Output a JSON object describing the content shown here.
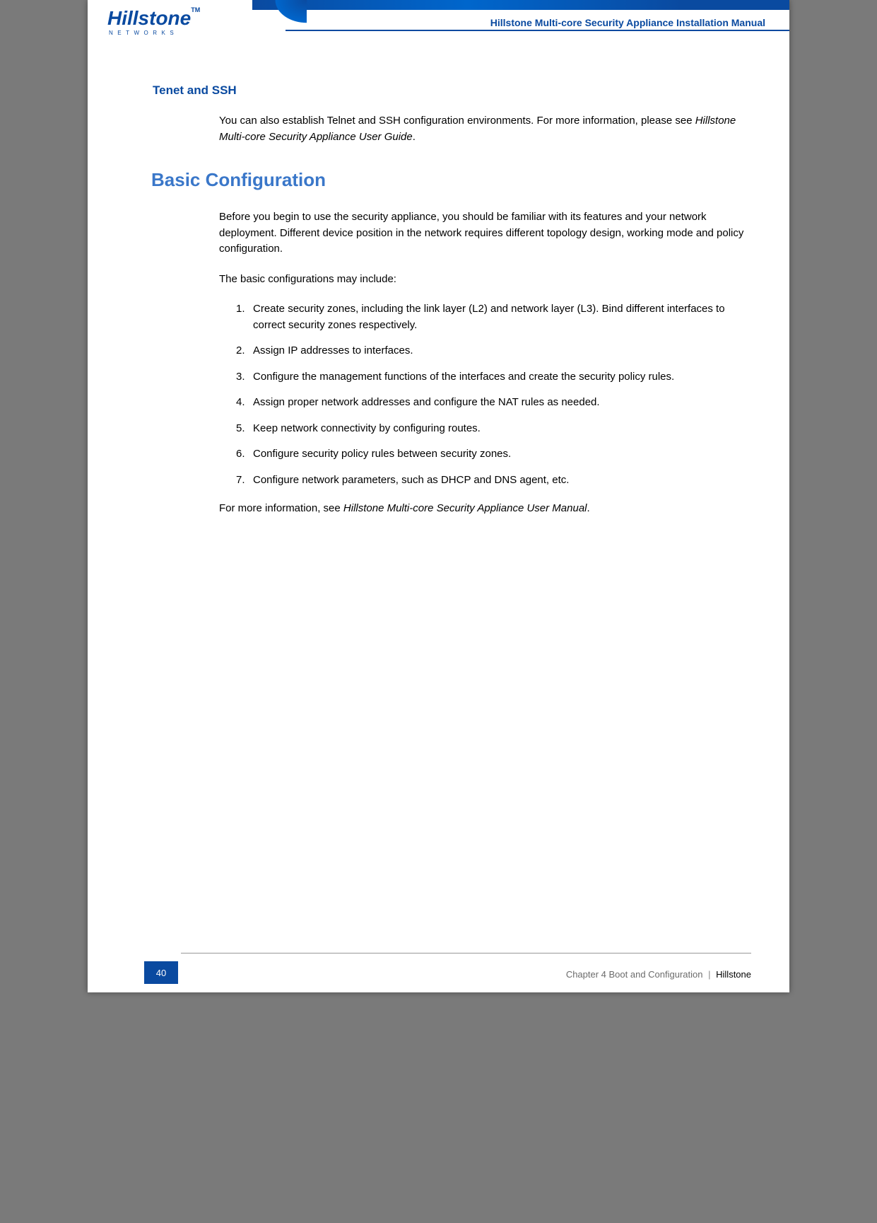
{
  "header": {
    "logo_main": "Hillstone",
    "logo_tm": "TM",
    "logo_sub": "NETWORKS",
    "title": "Hillstone Multi-core Security Appliance Installation Manual"
  },
  "section1": {
    "heading": "Tenet and SSH",
    "para_lead": "You can also establish Telnet and SSH configuration environments. For more information, please see ",
    "para_ref": "Hillstone Multi-core Security Appliance User Guide",
    "para_end": "."
  },
  "section2": {
    "heading": "Basic Configuration",
    "intro": "Before you begin to use the security appliance, you should be familiar with its features and your network deployment. Different device position in the network requires different topology design, working mode and policy configuration.",
    "lead": "The basic configurations may include:",
    "items": [
      "Create security zones, including the link layer (L2) and network layer (L3). Bind different interfaces to correct security zones respectively.",
      "Assign IP addresses to interfaces.",
      "Configure the management functions of the interfaces and create the security policy rules.",
      "Assign proper network addresses and configure the NAT rules as needed.",
      "Keep network connectivity by configuring routes.",
      "Configure security policy rules between security zones.",
      "Configure network parameters, such as DHCP and DNS agent, etc."
    ],
    "outro_lead": "For more information, see ",
    "outro_ref": "Hillstone Multi-core Security Appliance User Manual",
    "outro_end": "."
  },
  "footer": {
    "page": "40",
    "chapter": "Chapter 4 Boot and Configuration",
    "sep": "|",
    "brand": "Hillstone"
  }
}
